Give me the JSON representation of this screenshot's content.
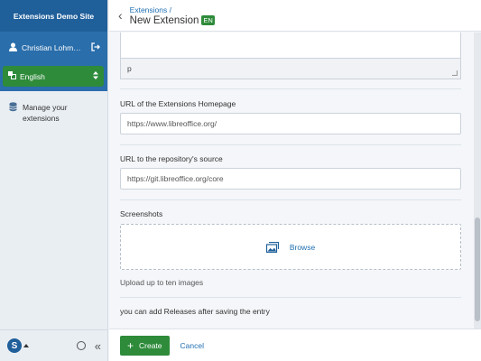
{
  "sidebar": {
    "site_title": "Extensions Demo Site",
    "user_name": "Christian Lohm…",
    "language": "English",
    "nav_items": [
      {
        "label": "Manage your extensions",
        "icon": "database-icon"
      }
    ]
  },
  "header": {
    "breadcrumb": "Extensions /",
    "title": "New Extension",
    "lang_badge": "EN"
  },
  "form": {
    "editor_status": "p",
    "homepage": {
      "label": "URL of the Extensions Homepage",
      "value": "https://www.libreoffice.org/"
    },
    "repository": {
      "label": "URL to the repository's source",
      "value": "https://git.libreoffice.org/core"
    },
    "screenshots": {
      "label": "Screenshots",
      "browse": "Browse",
      "hint": "Upload up to ten images"
    },
    "release_note": "you can add Releases after saving the entry"
  },
  "actions": {
    "create": "Create",
    "cancel": "Cancel"
  },
  "colors": {
    "primary_blue": "#1f5f9a",
    "accent_green": "#2e8b3a",
    "link_blue": "#1f6fb2"
  }
}
